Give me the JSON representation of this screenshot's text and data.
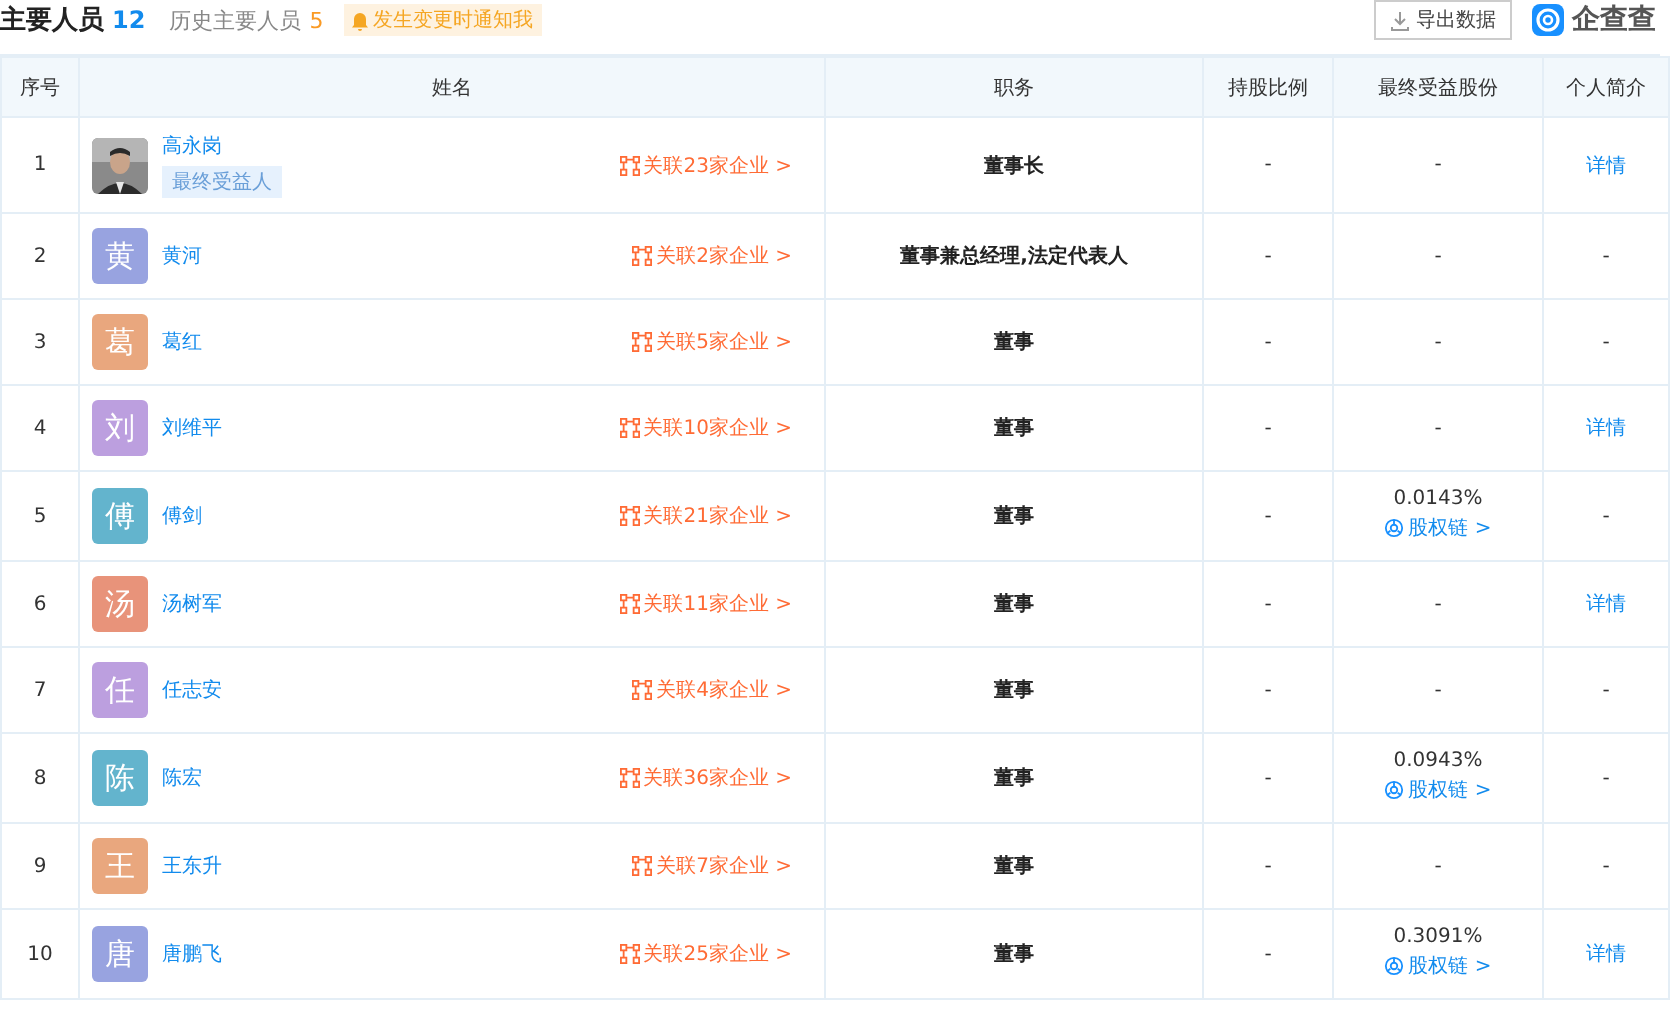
{
  "header": {
    "title": "主要人员",
    "count": "12",
    "history_label": "历史主要人员",
    "history_count": "5",
    "notify_label": "发生变更时通知我",
    "export_button": "导出数据",
    "logo_text": "企查查"
  },
  "table": {
    "columns": [
      "序号",
      "姓名",
      "职务",
      "持股比例",
      "最终受益股份",
      "个人简介"
    ],
    "rows": [
      {
        "index": "1",
        "name": "高永岗",
        "tag": "最终受益人",
        "related": "关联23家企业 >",
        "position": "董事长",
        "shareholding": "-",
        "beneficial": "-",
        "intro": "详情",
        "intro_link": true
      },
      {
        "index": "2",
        "avatar": {
          "kind": "letter",
          "text": "黄",
          "color": "#98a3e0"
        },
        "name": "黄河",
        "related": "关联2家企业 >",
        "position": "董事兼总经理,法定代表人",
        "shareholding": "-",
        "beneficial": "-",
        "intro": "-",
        "intro_link": false
      },
      {
        "index": "3",
        "avatar": {
          "kind": "letter",
          "text": "葛",
          "color": "#e9a77e"
        },
        "name": "葛红",
        "related": "关联5家企业 >",
        "position": "董事",
        "shareholding": "-",
        "beneficial": "-",
        "intro": "-",
        "intro_link": false
      },
      {
        "index": "4",
        "avatar": {
          "kind": "letter",
          "text": "刘",
          "color": "#bc9fdf"
        },
        "name": "刘维平",
        "related": "关联10家企业 >",
        "position": "董事",
        "shareholding": "-",
        "beneficial": "-",
        "intro": "详情",
        "intro_link": true
      },
      {
        "index": "5",
        "avatar": {
          "kind": "letter",
          "text": "傅",
          "color": "#63b4cd"
        },
        "name": "傅剑",
        "related": "关联21家企业 >",
        "position": "董事",
        "shareholding": "-",
        "beneficial": "0.0143%",
        "equity_link": "股权链 >",
        "intro": "-",
        "intro_link": false
      },
      {
        "index": "6",
        "avatar": {
          "kind": "letter",
          "text": "汤",
          "color": "#e8937a"
        },
        "name": "汤树军",
        "related": "关联11家企业 >",
        "position": "董事",
        "shareholding": "-",
        "beneficial": "-",
        "intro": "详情",
        "intro_link": true
      },
      {
        "index": "7",
        "avatar": {
          "kind": "letter",
          "text": "任",
          "color": "#bc9fdf"
        },
        "name": "任志安",
        "related": "关联4家企业 >",
        "position": "董事",
        "shareholding": "-",
        "beneficial": "-",
        "intro": "-",
        "intro_link": false
      },
      {
        "index": "8",
        "avatar": {
          "kind": "letter",
          "text": "陈",
          "color": "#63b4cd"
        },
        "name": "陈宏",
        "related": "关联36家企业 >",
        "position": "董事",
        "shareholding": "-",
        "beneficial": "0.0943%",
        "equity_link": "股权链 >",
        "intro": "-",
        "intro_link": false
      },
      {
        "index": "9",
        "avatar": {
          "kind": "letter",
          "text": "王",
          "color": "#e9a77e"
        },
        "name": "王东升",
        "related": "关联7家企业 >",
        "position": "董事",
        "shareholding": "-",
        "beneficial": "-",
        "intro": "-",
        "intro_link": false
      },
      {
        "index": "10",
        "avatar": {
          "kind": "letter",
          "text": "唐",
          "color": "#98a3e0"
        },
        "name": "唐鹏飞",
        "related": "关联25家企业 >",
        "position": "董事",
        "shareholding": "-",
        "beneficial": "0.3091%",
        "equity_link": "股权链 >",
        "intro": "详情",
        "intro_link": true
      }
    ]
  }
}
